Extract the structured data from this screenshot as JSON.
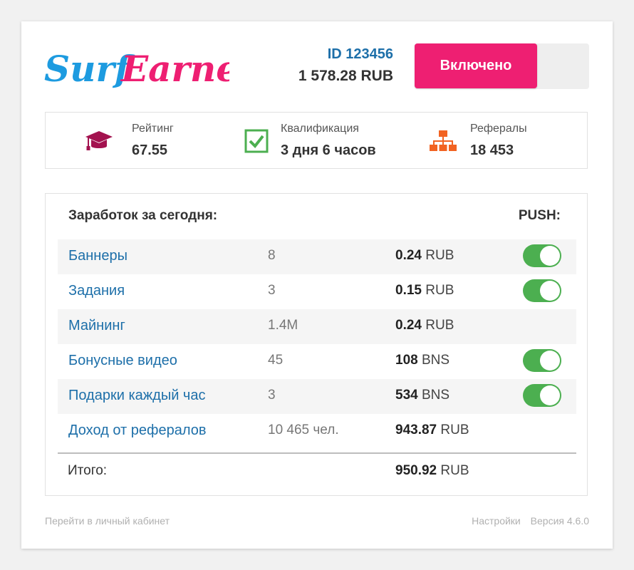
{
  "header": {
    "logo": {
      "part1": "Surf",
      "part2": "Earner"
    },
    "account_id": "ID 123456",
    "balance": "1 578.28 RUB",
    "status_toggle_label": "Включено"
  },
  "stats": [
    {
      "icon": "graduation-cap-icon",
      "label": "Рейтинг",
      "value": "67.55"
    },
    {
      "icon": "checkbox-icon",
      "label": "Квалификация",
      "value": "3 дня 6 часов"
    },
    {
      "icon": "hierarchy-icon",
      "label": "Рефералы",
      "value": "18 453"
    }
  ],
  "earnings": {
    "title": "Заработок за сегодня:",
    "push_label": "PUSH:",
    "rows": [
      {
        "name": "Баннеры",
        "count": "8",
        "amount": "0.24",
        "currency": "RUB",
        "push": true
      },
      {
        "name": "Задания",
        "count": "3",
        "amount": "0.15",
        "currency": "RUB",
        "push": true
      },
      {
        "name": "Майнинг",
        "count": "1.4M",
        "amount": "0.24",
        "currency": "RUB",
        "push": null
      },
      {
        "name": "Бонусные видео",
        "count": "45",
        "amount": "108",
        "currency": "BNS",
        "push": true
      },
      {
        "name": "Подарки каждый час",
        "count": "3",
        "amount": "534",
        "currency": "BNS",
        "push": true
      },
      {
        "name": "Доход от рефералов",
        "count": "10 465 чел.",
        "amount": "943.87",
        "currency": "RUB",
        "push": null
      }
    ],
    "total_label": "Итого:",
    "total_amount": "950.92",
    "total_currency": "RUB"
  },
  "footer": {
    "cabinet_link": "Перейти в личный кабинет",
    "settings_link": "Настройки",
    "version": "Версия 4.6.0"
  },
  "colors": {
    "brand_blue": "#1d9be0",
    "brand_pink": "#ee1f72",
    "link_blue": "#1d6fa9",
    "toggle_green": "#4caf50",
    "rating_icon": "#a3124f",
    "qualification_icon": "#4caf50",
    "referrals_icon": "#f26322"
  }
}
